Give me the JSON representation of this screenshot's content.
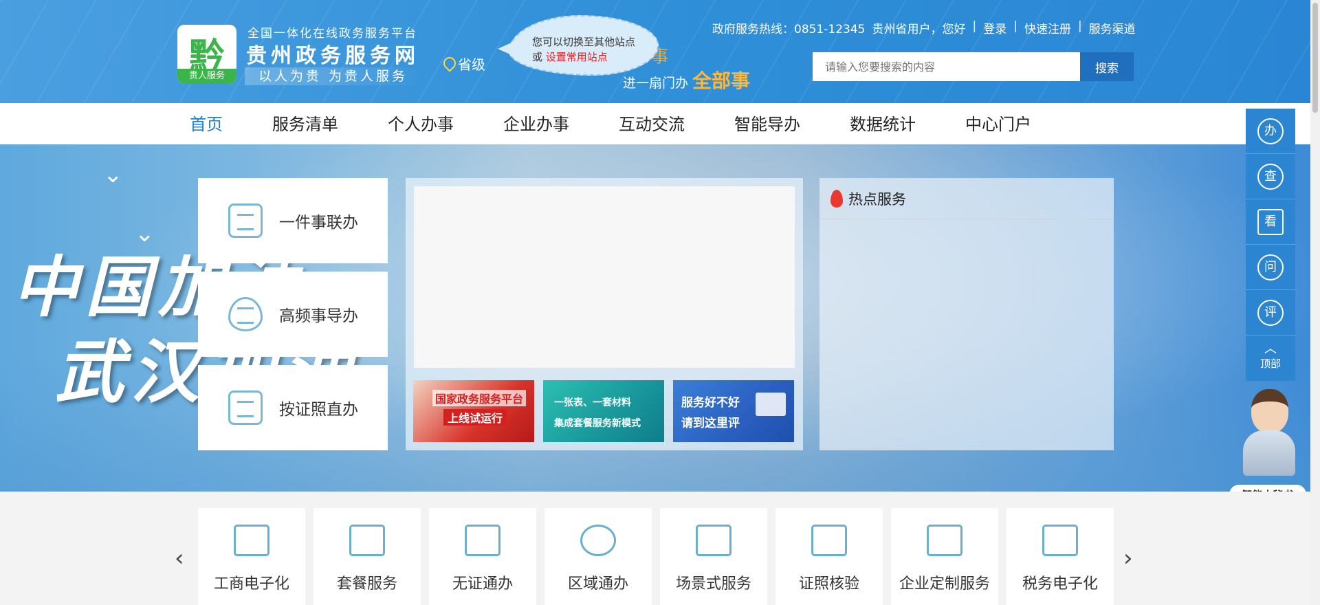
{
  "header": {
    "logo_glyph": "黔",
    "logo_tag": "贵人服务",
    "site_subtitle": "全国一体化在线政务服务平台",
    "site_title": "贵州政务服务网",
    "site_slogan": "以人为贵  为贵人服务",
    "location": "省级",
    "bubble_line1": "您可以切换至其他站点",
    "bubble_line2_prefix": "或 ",
    "bubble_line2_link": "设置常用站点",
    "slogan_faded": "一件事",
    "slogan_prefix": "进一扇门办 ",
    "slogan_emph": "全部事",
    "hotline_label": "政府服务热线：0851-12345",
    "greeting": "贵州省用户，您好",
    "login": "登录",
    "register": "快速注册",
    "channels": "服务渠道",
    "separator": "|",
    "search_placeholder": "请输入您要搜索的内容",
    "search_button": "搜索"
  },
  "nav": {
    "items": [
      "首页",
      "服务清单",
      "个人办事",
      "企业办事",
      "互动交流",
      "智能导办",
      "数据统计",
      "中心门户"
    ],
    "active_index": 0
  },
  "banner": {
    "calligraphy_line1": "中国加油",
    "calligraphy_line2": "武汉加油",
    "quick_items": [
      "一件事联办",
      "高频事导办",
      "按证照直办"
    ],
    "thumbs": [
      {
        "line1": "国家政务服务平台",
        "line2": "上线试运行"
      },
      {
        "line1": "一张表、一套材料",
        "line2": "集成套餐服务新模式"
      },
      {
        "line1": "服务好不好",
        "line2": "请到这里评"
      }
    ],
    "hot_title": "热点服务"
  },
  "float_bar": {
    "buttons": [
      "办",
      "查",
      "看",
      "问",
      "评"
    ],
    "top_label": "顶部",
    "assistant_label": "智能小秘书"
  },
  "services": {
    "items": [
      "工商电子化",
      "套餐服务",
      "无证通办",
      "区域通办",
      "场景式服务",
      "证照核验",
      "企业定制服务",
      "税务电子化"
    ],
    "prev_arrow": "‹",
    "next_arrow": "›"
  },
  "colors": {
    "header_blue": "#2f8fd8",
    "nav_active": "#1f7fd3",
    "search_button": "#1f6fbd",
    "float_blue": "#2b85d0",
    "accent_orange": "#ffb73a"
  }
}
